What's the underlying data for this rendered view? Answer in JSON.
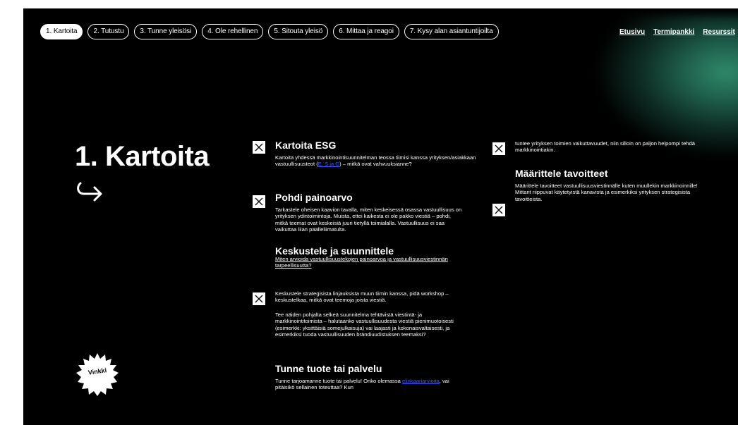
{
  "nav": {
    "pills": [
      "1. Kartoita",
      "2. Tutustu",
      "3. Tunne yleisösi",
      "4. Ole rehellinen",
      "5. Sitouta yleisö",
      "6. Mittaa ja reagoi",
      "7. Kysy alan asiantuntijoilta"
    ],
    "links": [
      "Etusivu",
      "Termipankki",
      "Resurssit"
    ]
  },
  "page": {
    "title": "1. Kartoita",
    "vinkki": "Vinkki"
  },
  "sections": {
    "kartoita_esg": {
      "title": "Kartoita ESG",
      "text_before": "Kartoita yhdessä markkinointisuunnitelman teossa tiimisi kanssa yrityksen/asiakkaan vastuullisuusteot (",
      "link": "E, S ja G",
      "text_after": ") – mitkä ovat vahvuuksianne?"
    },
    "pohdi": {
      "title": "Pohdi painoarvo",
      "text": "Tarkastele oheisen kaavion tavalla, miten keskeisessä osassa vastuullisuus on yrityksen ydintoimintoja. Muista, ettei kaikesta ei ole pakko viestiä – pohdi, mitkä teemat ovat keskeisiä juuri tietyllä toimialalla. Vastuullisuus ei saa vaikuttaa liian päälleliimatulta."
    },
    "keskustele": {
      "title": "Keskustele ja suunnittele",
      "link": "Miten arvioida vastuullisuustekojen painoarvoa ja vastuullisuusviestinnän tarpeellisuutta?",
      "text1": "Keskustele strategisista linjauksista muun tiimin kanssa, pidä workshop – keskustelkaa, mitkä ovat teemoja joista viestiä.",
      "text2": "Tee näiden pohjalta selkeä suunnitelma tehtävistä viestintä- ja markkinointitoimista – halutaanko vastuullisuudesta viestiä pienimuotoisesti (esimerkki: yksittäisiä somejulkaisuja) vai laajasti ja kokonaisvaltaisesti, ja esimerkiksi tuoda vastuullisuuden brändiuudistuksen teemaksi?"
    },
    "tunne": {
      "title": "Tunne tuote tai palvelu",
      "text_before": "Tunne tarjoamanne tuote tai palvelu! Onko olemassa",
      "link": "elinkaariarvioita",
      "text_after": ", vai pitäisikö sellainen toteuttaa? Kun"
    },
    "continued": {
      "text": "tuntee yrityksen toimien vaikuttavuudet, niin silloin on paljon helpompi tehdä markkinointiakin."
    },
    "maarittele": {
      "title": "Määrittele tavoitteet",
      "text": "Määrittele tavoitteet vastuullisuusviestinnälle kuten muullekin markkinoinnille! Mittarit riippuvat käytetyistä kanavista ja esimerkiksi yrityksen strategisista tavoitteista."
    }
  }
}
